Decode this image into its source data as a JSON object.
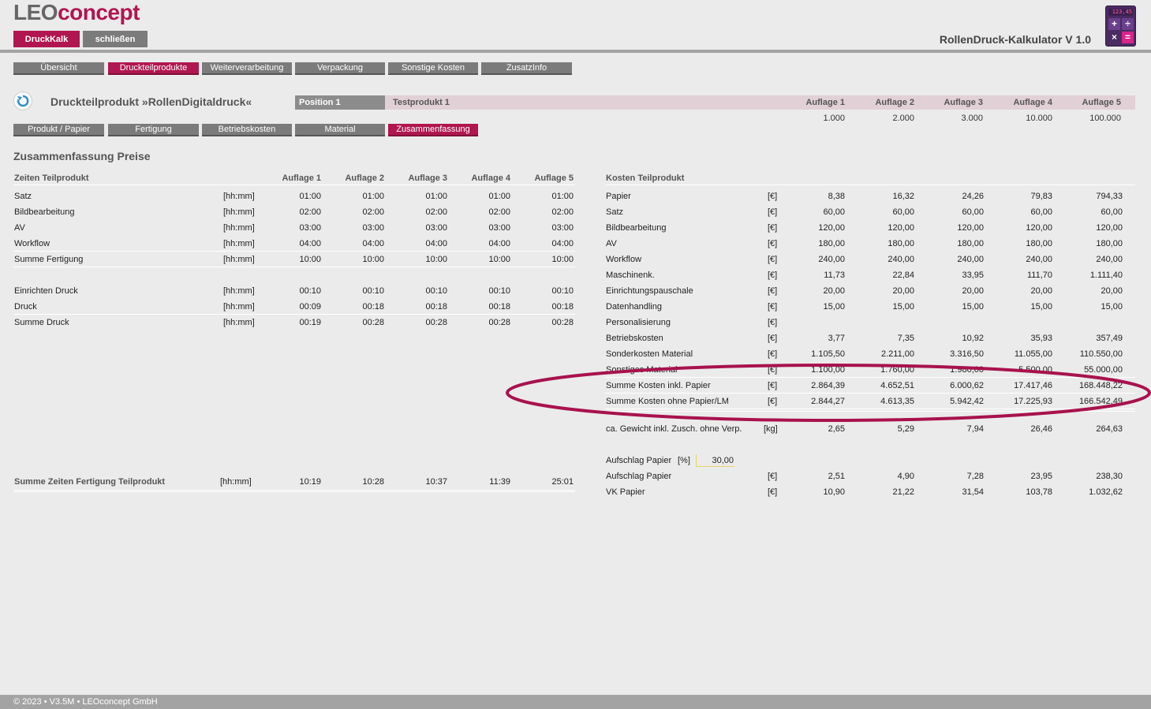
{
  "header": {
    "logo_left": "LEO",
    "logo_right": "concept",
    "btn_druckkalk": "DruckKalk",
    "btn_close": "schließen",
    "app_title": "RollenDruck-Kalkulator V 1.0",
    "calc_display": "123,45"
  },
  "nav_tabs": [
    "Übersicht",
    "Druckteilprodukte",
    "Weiterverarbeitung",
    "Verpackung",
    "Sonstige Kosten",
    "ZusatzInfo"
  ],
  "product": {
    "title": "Druckteilprodukt »RollenDigitaldruck«",
    "position": "Position 1",
    "name": "Testprodukt 1",
    "auflagen_headers": [
      "Auflage 1",
      "Auflage 2",
      "Auflage 3",
      "Auflage 4",
      "Auflage 5"
    ],
    "auflagen_values": [
      "1.000",
      "2.000",
      "3.000",
      "10.000",
      "100.000"
    ]
  },
  "sub_tabs": [
    "Produkt / Papier",
    "Fertigung",
    "Betriebskosten",
    "Material",
    "Zusammenfassung"
  ],
  "summary_title": "Zusammenfassung Preise",
  "zeiten": {
    "header": "Zeiten Teilprodukt",
    "cols": [
      "Auflage 1",
      "Auflage 2",
      "Auflage 3",
      "Auflage 4",
      "Auflage 5"
    ],
    "rows": [
      {
        "label": "Satz",
        "unit": "[hh:mm]",
        "v": [
          "01:00",
          "01:00",
          "01:00",
          "01:00",
          "01:00"
        ]
      },
      {
        "label": "Bildbearbeitung",
        "unit": "[hh:mm]",
        "v": [
          "02:00",
          "02:00",
          "02:00",
          "02:00",
          "02:00"
        ]
      },
      {
        "label": "AV",
        "unit": "[hh:mm]",
        "v": [
          "03:00",
          "03:00",
          "03:00",
          "03:00",
          "03:00"
        ]
      },
      {
        "label": "Workflow",
        "unit": "[hh:mm]",
        "v": [
          "04:00",
          "04:00",
          "04:00",
          "04:00",
          "04:00"
        ],
        "sep": true
      },
      {
        "label": "Summe Fertigung",
        "unit": "[hh:mm]",
        "v": [
          "10:00",
          "10:00",
          "10:00",
          "10:00",
          "10:00"
        ],
        "sep": true
      },
      {
        "label": "",
        "unit": "",
        "v": [
          "",
          "",
          "",
          "",
          ""
        ]
      },
      {
        "label": "Einrichten Druck",
        "unit": "[hh:mm]",
        "v": [
          "00:10",
          "00:10",
          "00:10",
          "00:10",
          "00:10"
        ]
      },
      {
        "label": "Druck",
        "unit": "[hh:mm]",
        "v": [
          "00:09",
          "00:18",
          "00:18",
          "00:18",
          "00:18"
        ],
        "sep": true
      },
      {
        "label": "Summe Druck",
        "unit": "[hh:mm]",
        "v": [
          "00:19",
          "00:28",
          "00:28",
          "00:28",
          "00:28"
        ]
      }
    ],
    "total": {
      "label": "Summe Zeiten Fertigung Teilprodukt",
      "unit": "[hh:mm]",
      "v": [
        "10:19",
        "10:28",
        "10:37",
        "11:39",
        "25:01"
      ]
    }
  },
  "kosten": {
    "header": "Kosten Teilprodukt",
    "rows": [
      {
        "label": "Papier",
        "unit": "[€]",
        "v": [
          "8,38",
          "16,32",
          "24,26",
          "79,83",
          "794,33"
        ]
      },
      {
        "label": "Satz",
        "unit": "[€]",
        "v": [
          "60,00",
          "60,00",
          "60,00",
          "60,00",
          "60,00"
        ]
      },
      {
        "label": "Bildbearbeitung",
        "unit": "[€]",
        "v": [
          "120,00",
          "120,00",
          "120,00",
          "120,00",
          "120,00"
        ]
      },
      {
        "label": "AV",
        "unit": "[€]",
        "v": [
          "180,00",
          "180,00",
          "180,00",
          "180,00",
          "180,00"
        ]
      },
      {
        "label": "Workflow",
        "unit": "[€]",
        "v": [
          "240,00",
          "240,00",
          "240,00",
          "240,00",
          "240,00"
        ]
      },
      {
        "label": "Maschinenk.",
        "unit": "[€]",
        "v": [
          "11,73",
          "22,84",
          "33,95",
          "111,70",
          "1.111,40"
        ]
      },
      {
        "label": "Einrichtungspauschale",
        "unit": "[€]",
        "v": [
          "20,00",
          "20,00",
          "20,00",
          "20,00",
          "20,00"
        ]
      },
      {
        "label": "Datenhandling",
        "unit": "[€]",
        "v": [
          "15,00",
          "15,00",
          "15,00",
          "15,00",
          "15,00"
        ]
      },
      {
        "label": "Personalisierung",
        "unit": "[€]",
        "v": [
          "",
          "",
          "",
          "",
          ""
        ]
      },
      {
        "label": "Betriebskosten",
        "unit": "[€]",
        "v": [
          "3,77",
          "7,35",
          "10,92",
          "35,93",
          "357,49"
        ]
      },
      {
        "label": "Sonderkosten Material",
        "unit": "[€]",
        "v": [
          "1.105,50",
          "2.211,00",
          "3.316,50",
          "11.055,00",
          "110.550,00"
        ]
      },
      {
        "label": "Sonstiges Material",
        "unit": "[€]",
        "v": [
          "1.100,00",
          "1.760,00",
          "1.980,00",
          "5.500,00",
          "55.000,00"
        ],
        "sep": true
      },
      {
        "label": "Summe Kosten inkl. Papier",
        "unit": "[€]",
        "v": [
          "2.864,39",
          "4.652,51",
          "6.000,62",
          "17.417,46",
          "168.448,22"
        ],
        "sep": true
      },
      {
        "label": "Summe Kosten ohne Papier/LM",
        "unit": "[€]",
        "v": [
          "2.844,27",
          "4.613,35",
          "5.942,42",
          "17.225,93",
          "166.542,49"
        ],
        "sep": true
      }
    ],
    "gewicht": {
      "label": "ca. Gewicht inkl. Zusch. ohne Verp.",
      "unit": "[kg]",
      "v": [
        "2,65",
        "5,29",
        "7,94",
        "26,46",
        "264,63"
      ]
    },
    "aufschlag_pct": {
      "label": "Aufschlag Papier",
      "unit": "[%]",
      "value": "30,00"
    },
    "aufschlag_eur": {
      "label": "Aufschlag Papier",
      "unit": "[€]",
      "v": [
        "2,51",
        "4,90",
        "7,28",
        "23,95",
        "238,30"
      ]
    },
    "vk_papier": {
      "label": "VK Papier",
      "unit": "[€]",
      "v": [
        "10,90",
        "21,22",
        "31,54",
        "103,78",
        "1.032,62"
      ]
    }
  },
  "footer": "© 2023 • V3.5M • LEOconcept GmbH",
  "colors": {
    "accent": "#b0164f",
    "tab_gray": "#7b7b7b",
    "highlight_ellipse": "#a8124e"
  }
}
